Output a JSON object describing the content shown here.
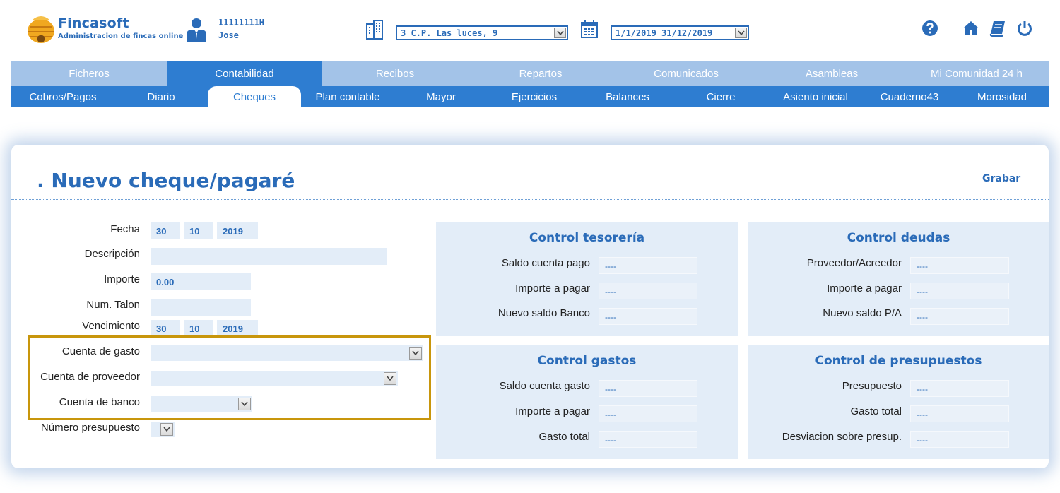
{
  "brand": {
    "name": "Fincasoft",
    "tagline": "Administracion de fincas online"
  },
  "user": {
    "id": "11111111H",
    "name": "Jose"
  },
  "selectors": {
    "community": "3 C.P. Las luces, 9",
    "period": "1/1/2019  31/12/2019"
  },
  "top_icons": [
    "help-icon",
    "home-icon",
    "manual-icon",
    "power-icon"
  ],
  "nav": {
    "main": [
      "Ficheros",
      "Contabilidad",
      "Recibos",
      "Repartos",
      "Comunicados",
      "Asambleas",
      "Mi Comunidad 24 h"
    ],
    "main_active": "Contabilidad",
    "sub": [
      "Cobros/Pagos",
      "Diario",
      "Cheques",
      "Plan contable",
      "Mayor",
      "Ejercicios",
      "Balances",
      "Cierre",
      "Asiento inicial",
      "Cuaderno43",
      "Morosidad"
    ],
    "sub_active": "Cheques"
  },
  "page": {
    "title": ". Nuevo cheque/pagaré",
    "save_label": "Grabar"
  },
  "form": {
    "fecha": {
      "label": "Fecha",
      "day": "30",
      "month": "10",
      "year": "2019"
    },
    "descripcion": {
      "label": "Descripción",
      "value": ""
    },
    "importe": {
      "label": "Importe",
      "value": "0.00"
    },
    "num_talon": {
      "label": "Num. Talon",
      "value": ""
    },
    "vencimiento": {
      "label": "Vencimiento",
      "day": "30",
      "month": "10",
      "year": "2019"
    },
    "cuenta_gasto": {
      "label": "Cuenta de gasto",
      "value": ""
    },
    "cuenta_proveedor": {
      "label": "Cuenta de proveedor",
      "value": ""
    },
    "cuenta_banco": {
      "label": "Cuenta de banco",
      "value": ""
    },
    "numero_presupuesto": {
      "label": "Número presupuesto",
      "value": ""
    }
  },
  "panels": {
    "tesoreria": {
      "title": "Control tesorería",
      "rows": [
        {
          "label": "Saldo cuenta pago",
          "value": "----"
        },
        {
          "label": "Importe a pagar",
          "value": "----"
        },
        {
          "label": "Nuevo saldo Banco",
          "value": "----"
        }
      ]
    },
    "deudas": {
      "title": "Control deudas",
      "rows": [
        {
          "label": "Proveedor/Acreedor",
          "value": "----"
        },
        {
          "label": "Importe a pagar",
          "value": "----"
        },
        {
          "label": "Nuevo saldo P/A",
          "value": "----"
        }
      ]
    },
    "gastos": {
      "title": "Control gastos",
      "rows": [
        {
          "label": "Saldo cuenta gasto",
          "value": "----"
        },
        {
          "label": "Importe a pagar",
          "value": "----"
        },
        {
          "label": "Gasto total",
          "value": "----"
        }
      ]
    },
    "presupuestos": {
      "title": "Control de presupuestos",
      "rows": [
        {
          "label": "Presupuesto",
          "value": "----"
        },
        {
          "label": "Gasto total",
          "value": "----"
        },
        {
          "label": "Desviacion sobre presup.",
          "value": "----"
        }
      ]
    }
  },
  "colors": {
    "brand_blue": "#2a6bb8",
    "nav_blue": "#2e7dd1",
    "nav_light": "#a3c3e8",
    "field_bg": "#e3edf8",
    "highlight": "#c8960c"
  }
}
